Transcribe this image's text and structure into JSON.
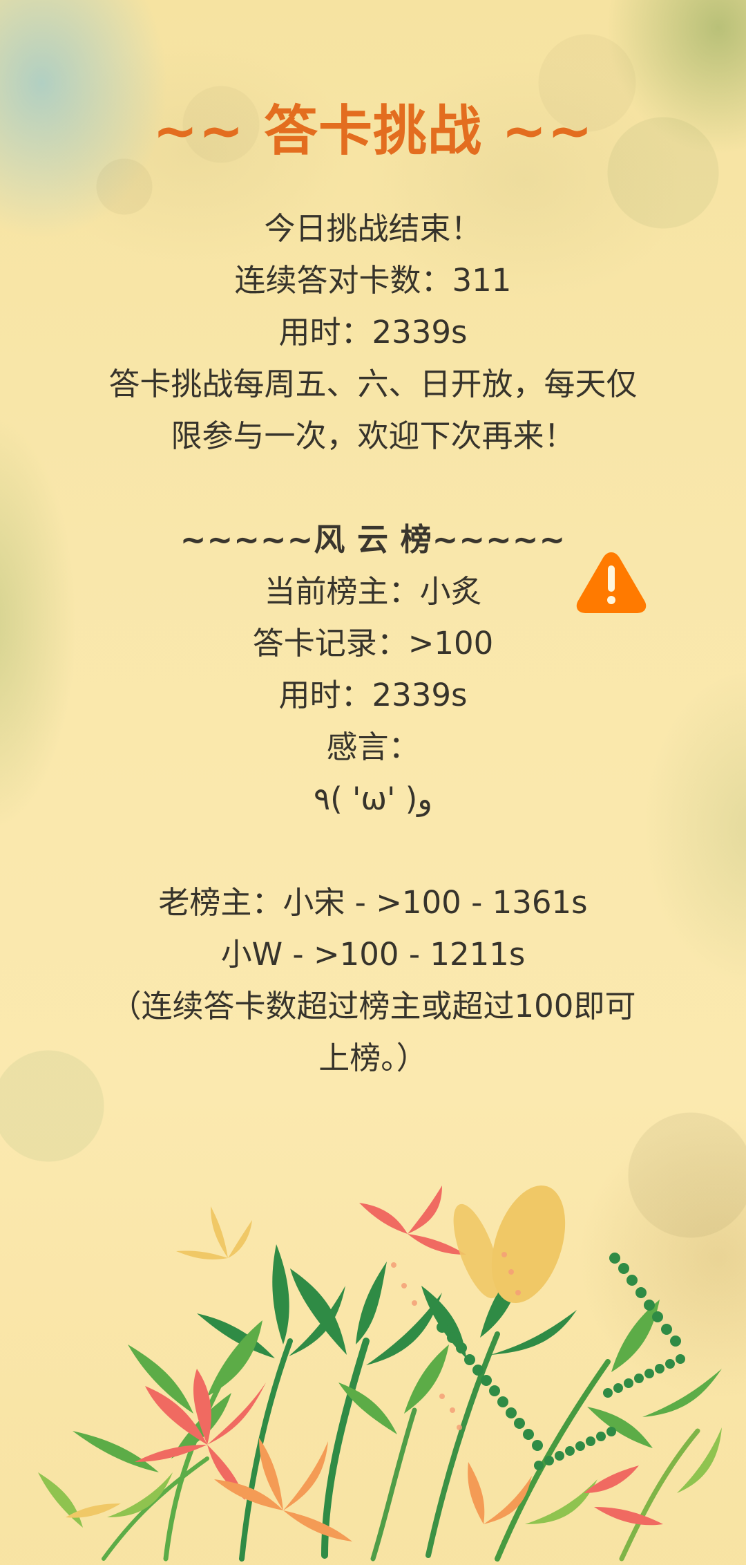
{
  "header": {
    "title": "~~ 答卡挑战 ~~"
  },
  "challenge": {
    "status": "今日挑战结束！",
    "streak": "连续答对卡数：311",
    "time": "用时：2339s",
    "notice_line1": "答卡挑战每周五、六、日开放，每天仅",
    "notice_line2": "限参与一次，欢迎下次再来！"
  },
  "leaderboard": {
    "heading": "~~~~~风 云 榜~~~~~",
    "current_leader": "当前榜主：小炙",
    "record": "答卡记录：>100",
    "time": "用时：2339s",
    "comment_label": "感言：",
    "comment": "٩( 'ω' )و",
    "former_leader_1": "老榜主：小宋 - >100 - 1361s",
    "former_leader_2": "小W - >100 - 1211s",
    "rule_line1": "（连续答卡数超过榜主或超过100即可",
    "rule_line2": "上榜。）"
  },
  "icons": {
    "warning": "warning-icon"
  },
  "colors": {
    "title": "#e36d1f",
    "text": "#36332b",
    "warning": "#ff7a00",
    "background": "#f9e7a7"
  }
}
